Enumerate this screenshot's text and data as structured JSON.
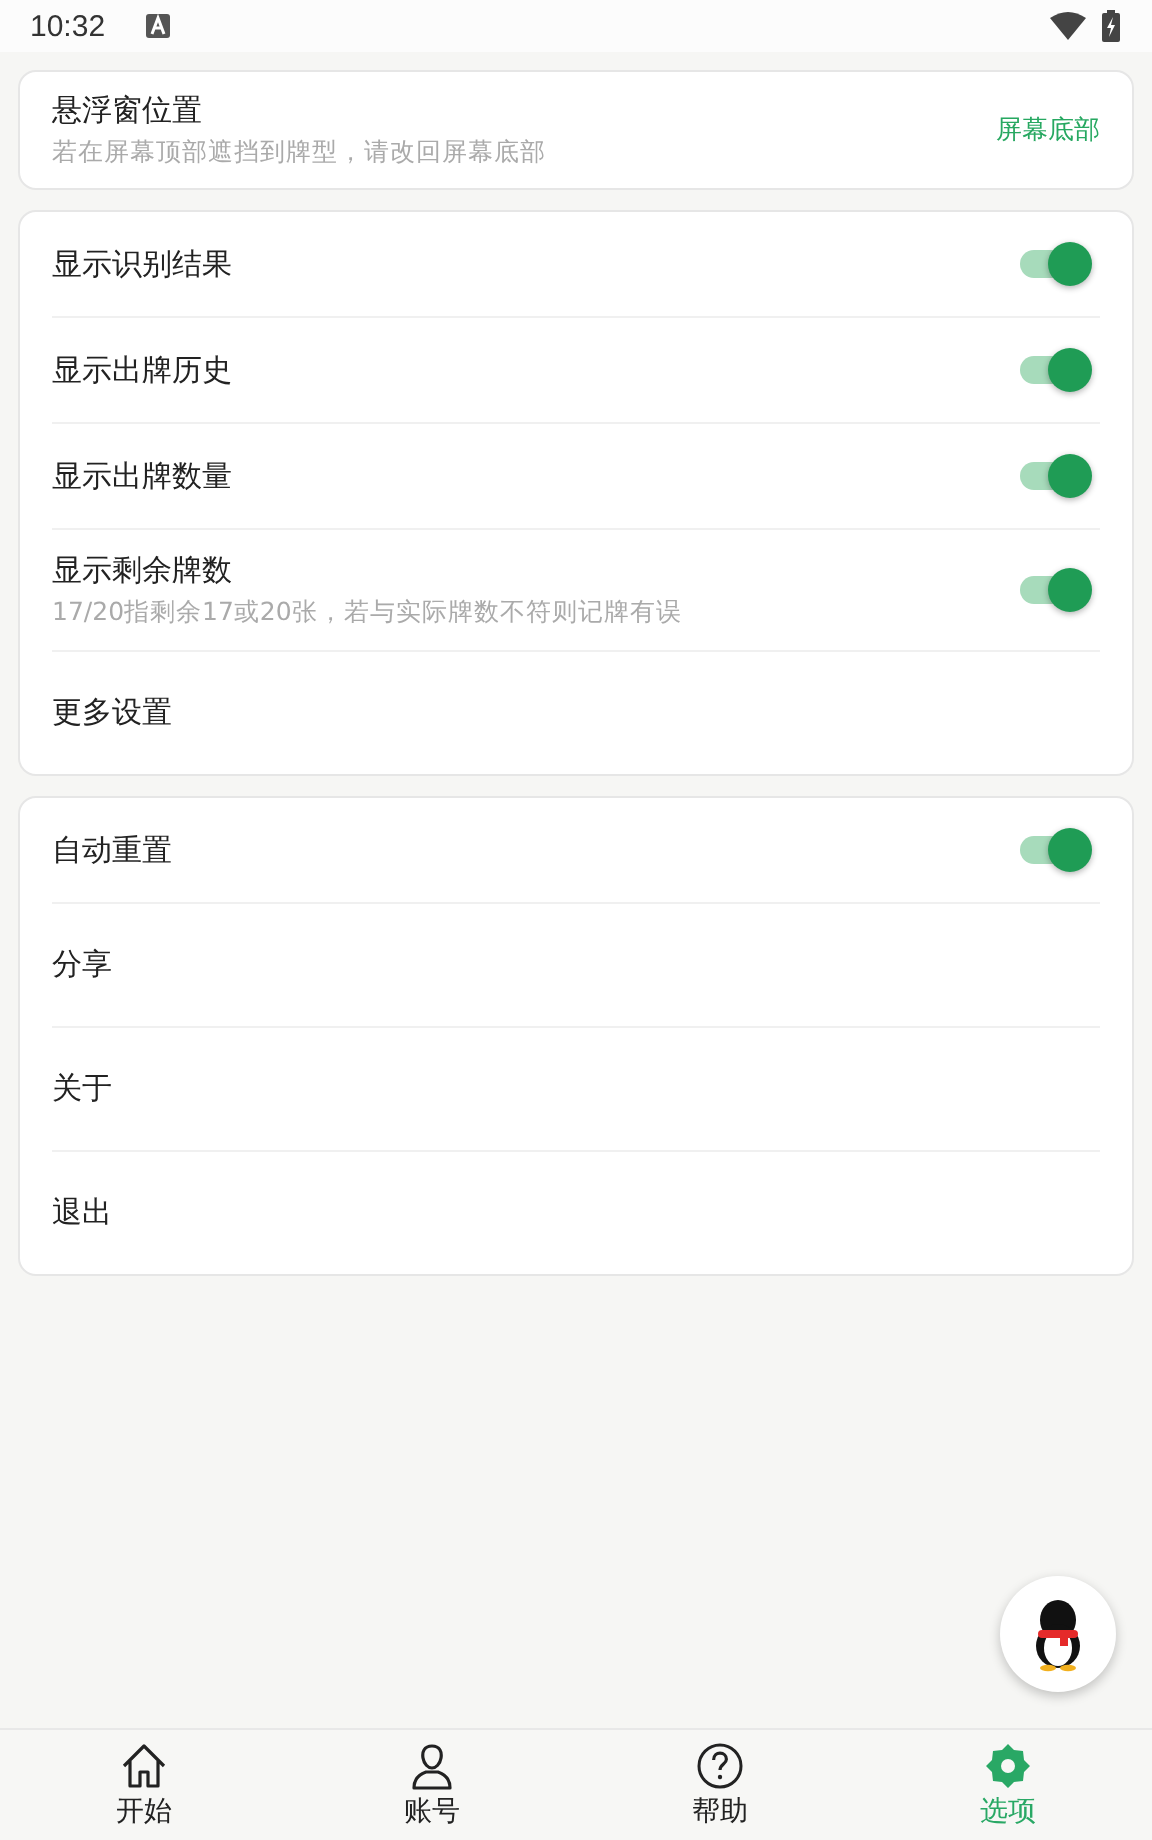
{
  "status_bar": {
    "time": "10:32"
  },
  "sections": [
    {
      "rows": [
        {
          "kind": "value",
          "title": "悬浮窗位置",
          "subtitle": "若在屏幕顶部遮挡到牌型，请改回屏幕底部",
          "value": "屏幕底部"
        }
      ]
    },
    {
      "rows": [
        {
          "kind": "toggle",
          "title": "显示识别结果",
          "on": true
        },
        {
          "kind": "toggle",
          "title": "显示出牌历史",
          "on": true
        },
        {
          "kind": "toggle",
          "title": "显示出牌数量",
          "on": true
        },
        {
          "kind": "toggle",
          "title": "显示剩余牌数",
          "subtitle": "17/20指剩余17或20张，若与实际牌数不符则记牌有误",
          "on": true
        },
        {
          "kind": "link",
          "title": "更多设置"
        }
      ]
    },
    {
      "rows": [
        {
          "kind": "toggle",
          "title": "自动重置",
          "on": true
        },
        {
          "kind": "link",
          "title": "分享"
        },
        {
          "kind": "link",
          "title": "关于"
        },
        {
          "kind": "link",
          "title": "退出"
        }
      ]
    }
  ],
  "bottom_nav": [
    {
      "kind": "home",
      "label": "开始",
      "selected": false
    },
    {
      "kind": "account",
      "label": "账号",
      "selected": false
    },
    {
      "kind": "help",
      "label": "帮助",
      "selected": false
    },
    {
      "kind": "settings",
      "label": "选项",
      "selected": true
    }
  ]
}
